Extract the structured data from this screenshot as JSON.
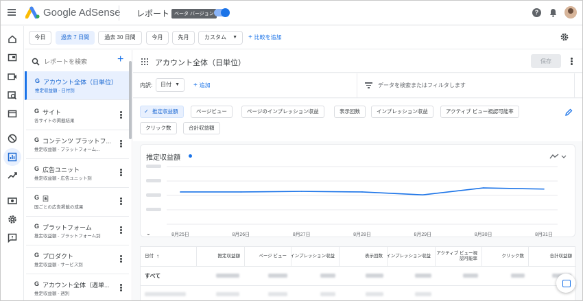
{
  "header": {
    "brand": "Google AdSense",
    "title": "レポート",
    "beta_badge": "ベータ バージョン"
  },
  "date_range": {
    "chips": [
      "今日",
      "過去 7 日間",
      "過去 30 日間",
      "今月",
      "先月",
      "カスタム"
    ],
    "active_index": 1,
    "add_compare": "比較を追加"
  },
  "report_list": {
    "search_placeholder": "レポートを検索",
    "items": [
      {
        "title": "アカウント全体（日単位）",
        "subtitle": "推定収益額 - 日付別"
      },
      {
        "title": "サイト",
        "subtitle": "各サイトの掲載結果"
      },
      {
        "title": "コンテンツ プラットフ...",
        "subtitle": "推定収益額 - プラットフォーム..."
      },
      {
        "title": "広告ユニット",
        "subtitle": "推定収益額 - 広告ユニット別"
      },
      {
        "title": "国",
        "subtitle": "国ごとの広告掲載の成果"
      },
      {
        "title": "プラットフォーム",
        "subtitle": "推定収益額 - プラットフォーム別"
      },
      {
        "title": "プロダクト",
        "subtitle": "推定収益額 - サービス別"
      },
      {
        "title": "アカウント全体（週単...",
        "subtitle": "推定収益額 - 週別"
      }
    ]
  },
  "main": {
    "title": "アカウント全体（日単位）",
    "save_label": "保存",
    "breakdown_label": "内訳:",
    "breakdown_value": "日付",
    "add_dimension": "追加",
    "filter_placeholder": "データを検索またはフィルタします",
    "metrics": [
      "推定収益額",
      "ページビュー",
      "ページのインプレッション収益",
      "表示回数",
      "インプレッション収益",
      "アクティブ ビュー視認可能率",
      "クリック数",
      "合計収益額"
    ],
    "active_metric_index": 0
  },
  "chart": {
    "title": "推定収益額"
  },
  "chart_data": {
    "type": "line",
    "title": "推定収益額",
    "categories": [
      "8月25日",
      "8月26日",
      "8月27日",
      "8月28日",
      "8月29日",
      "8月30日",
      "8月31日"
    ],
    "series": [
      {
        "values": [
          0.56,
          0.56,
          0.57,
          0.56,
          0.51,
          0.63,
          0.61
        ]
      }
    ],
    "ylim": [
      0,
      1
    ],
    "grid": true,
    "legend": "none"
  },
  "table": {
    "headers": [
      "日付",
      "推定収益額",
      "ページ ビュー",
      "ページのインプレッション収益",
      "表示回数",
      "インプレッション収益",
      "アクティブ ビュー視認可能率",
      "クリック数",
      "合計収益額"
    ],
    "total_label": "すべて"
  },
  "colors": {
    "accent": "#1a73e8",
    "selected_bg": "#e8f0fe"
  }
}
